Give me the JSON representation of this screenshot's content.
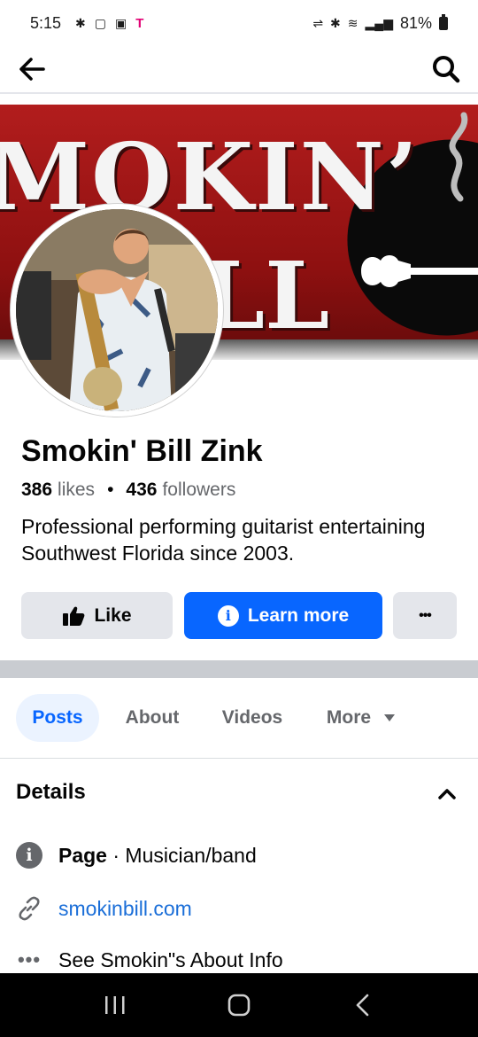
{
  "status_bar": {
    "time": "5:15",
    "carrier_glyph": "T",
    "battery": "81%"
  },
  "nav": {
    "back_icon": "arrow-left-icon",
    "search_icon": "search-icon"
  },
  "cover": {
    "line1": "MOKIN’",
    "line2": "LL",
    "colors": {
      "band": "#b21d1d",
      "text": "#f4f4f4",
      "ellipse": "#0a0a0a"
    }
  },
  "profile": {
    "name": "Smokin' Bill Zink",
    "likes_count": "386",
    "likes_label": "likes",
    "separator": "•",
    "followers_count": "436",
    "followers_label": "followers",
    "bio": "Professional performing guitarist entertaining Southwest Florida since 2003."
  },
  "actions": {
    "like_label": "Like",
    "learn_more_label": "Learn more",
    "more_label": "•••"
  },
  "tabs": [
    {
      "label": "Posts",
      "active": true
    },
    {
      "label": "About",
      "active": false
    },
    {
      "label": "Videos",
      "active": false
    },
    {
      "label": "More",
      "active": false
    }
  ],
  "details": {
    "title": "Details",
    "page_label": "Page",
    "page_category": " · Musician/band",
    "website": "smokinbill.com",
    "about_dots": "•••",
    "about_info": "See Smokin\"s About Info"
  },
  "colors": {
    "accent": "#0866ff",
    "secondary_text": "#65676b",
    "button_grey": "#e4e6eb"
  }
}
